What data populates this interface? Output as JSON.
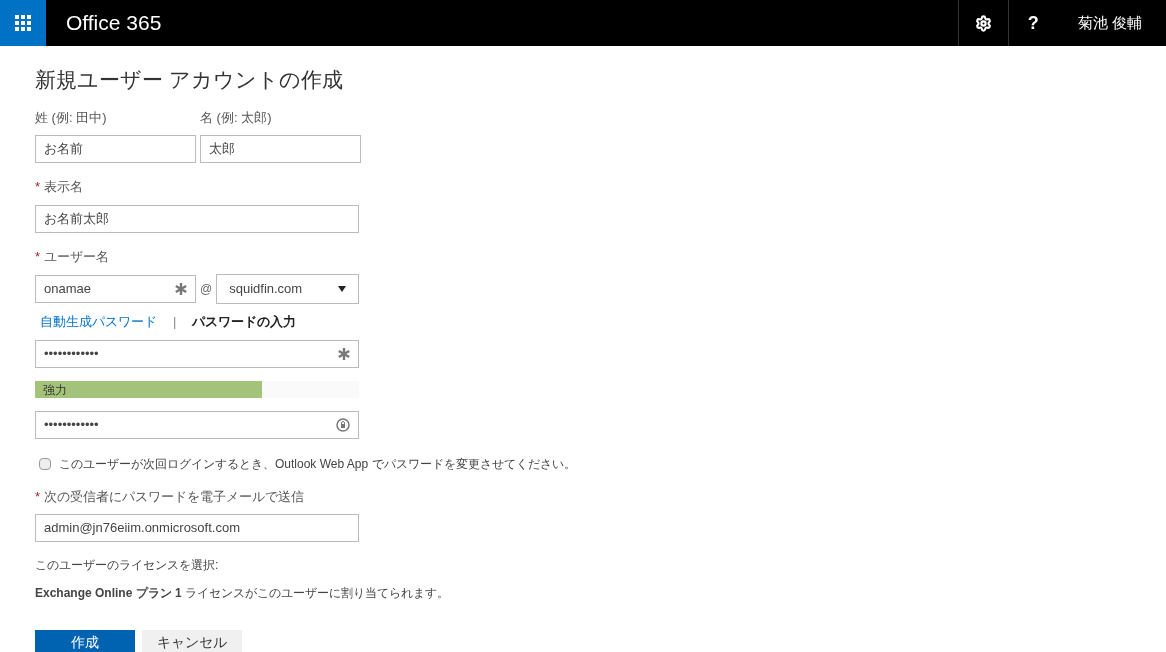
{
  "header": {
    "app_title": "Office 365",
    "user_name": "菊池 俊輔",
    "help_label": "?"
  },
  "required_mark": "*",
  "page_title": "新規ユーザー アカウントの作成",
  "last_name": {
    "label": "姓 (例: 田中)",
    "value": "お名前"
  },
  "first_name": {
    "label": "名 (例: 太郎)",
    "value": "太郎"
  },
  "display_name": {
    "label": "表示名",
    "required": true,
    "value": "お名前太郎"
  },
  "user_name": {
    "label": "ユーザー名",
    "required": true,
    "value": "onamae",
    "at": "@",
    "domain": "squidfin.com"
  },
  "password_modes": [
    {
      "label": "自動生成パスワード",
      "selected": false
    },
    {
      "label": "パスワードの入力",
      "selected": true
    }
  ],
  "password_separator": "|",
  "password": {
    "value": "••••••••••••"
  },
  "strength": {
    "label": "強力",
    "level": 0.7
  },
  "password_confirm": {
    "value": "••••••••••••"
  },
  "change_password_option": {
    "label": "このユーザーが次回ログインするとき、Outlook Web App でパスワードを変更させてください。",
    "checked": false
  },
  "send_email": {
    "label": "次の受信者にパスワードを電子メールで送信",
    "required": true,
    "value": "admin@jn76eiim.onmicrosoft.com"
  },
  "license_label": "このユーザーのライセンスを選択:",
  "license_text": "**Exchange Online プラン 1** ライセンスがこのユーザーに割り当てられます。",
  "buttons": [
    {
      "label": "作成",
      "kind": "primary"
    },
    {
      "label": "キャンセル",
      "kind": "secondary"
    }
  ]
}
